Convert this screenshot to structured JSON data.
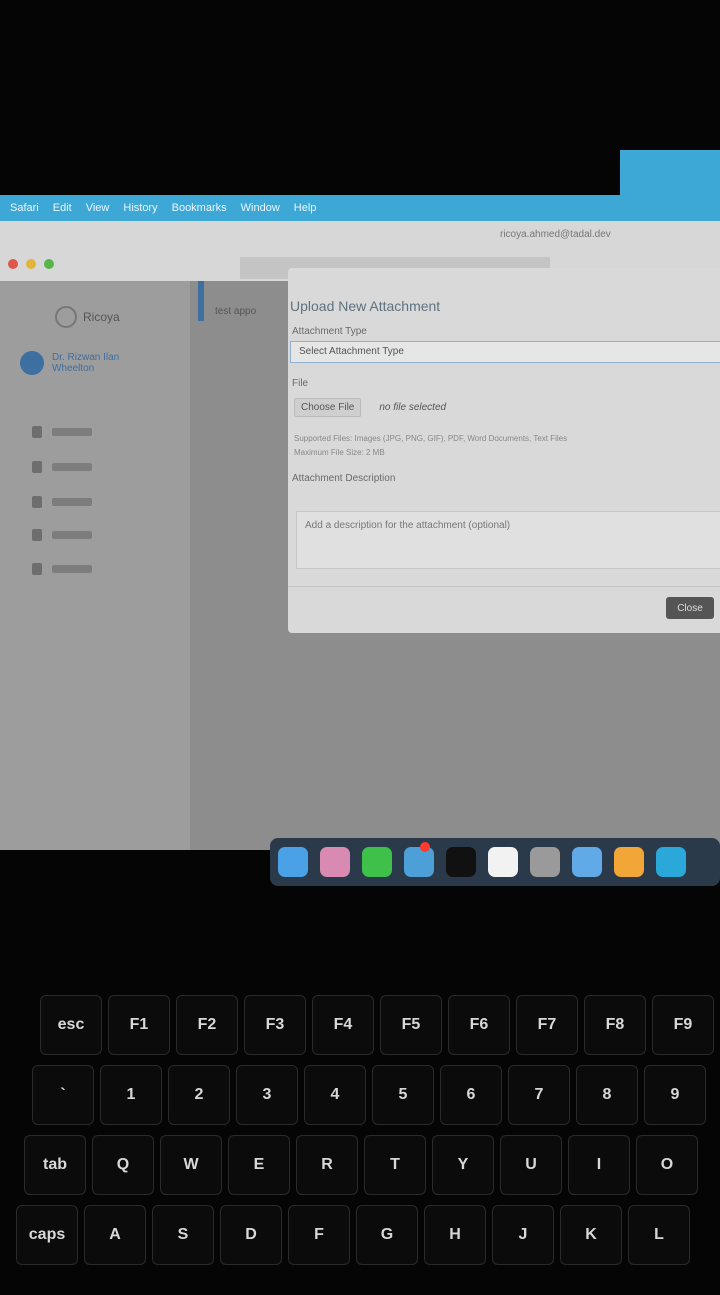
{
  "menubar": {
    "items": [
      "Safari",
      "Edit",
      "View",
      "History",
      "Bookmarks",
      "Window",
      "Help"
    ]
  },
  "browser": {
    "title_text": "ricoya.ahmed@tadal.dev"
  },
  "sidebar": {
    "brand": "Ricoya",
    "user": "Dr. Rizwan Ilan Wheelton",
    "nav_count": 5
  },
  "app": {
    "content_text": "test appo"
  },
  "modal": {
    "title": "Upload New Attachment",
    "attachment_type_label": "Attachment Type",
    "attachment_type_value": "Select Attachment Type",
    "file_label": "File",
    "choose_file": "Choose File",
    "file_status": "no file selected",
    "supported": "Supported Files: Images (JPG, PNG, GIF), PDF, Word Documents, Text Files",
    "max_size": "Maximum File Size: 2 MB",
    "description_label": "Attachment Description",
    "description_placeholder": "Add a description for the attachment (optional)",
    "close": "Close"
  },
  "dock": {
    "apps": [
      {
        "name": "finder",
        "color": "#4aa1e6"
      },
      {
        "name": "launchpad",
        "color": "#d98ab3"
      },
      {
        "name": "whatsapp",
        "color": "#3fc04a"
      },
      {
        "name": "telegram",
        "color": "#4d9fd8"
      },
      {
        "name": "terminal",
        "color": "#111111"
      },
      {
        "name": "calendar",
        "color": "#f2f2f2"
      },
      {
        "name": "system-settings",
        "color": "#9a9a9a"
      },
      {
        "name": "safari",
        "color": "#62a9e8"
      },
      {
        "name": "sublime-text",
        "color": "#f1a637"
      },
      {
        "name": "app",
        "color": "#2aa8d9"
      }
    ],
    "badge": "1"
  },
  "keyboard": {
    "row1": [
      "esc",
      "F1",
      "F2",
      "F3",
      "F4",
      "F5",
      "F6",
      "F7",
      "F8",
      "F9"
    ],
    "row2": [
      "`",
      "1",
      "2",
      "3",
      "4",
      "5",
      "6",
      "7",
      "8",
      "9"
    ],
    "row3": [
      "tab",
      "Q",
      "W",
      "E",
      "R",
      "T",
      "Y",
      "U",
      "I",
      "O"
    ],
    "row4": [
      "caps",
      "A",
      "S",
      "D",
      "F",
      "G",
      "H",
      "J",
      "K",
      "L"
    ]
  }
}
